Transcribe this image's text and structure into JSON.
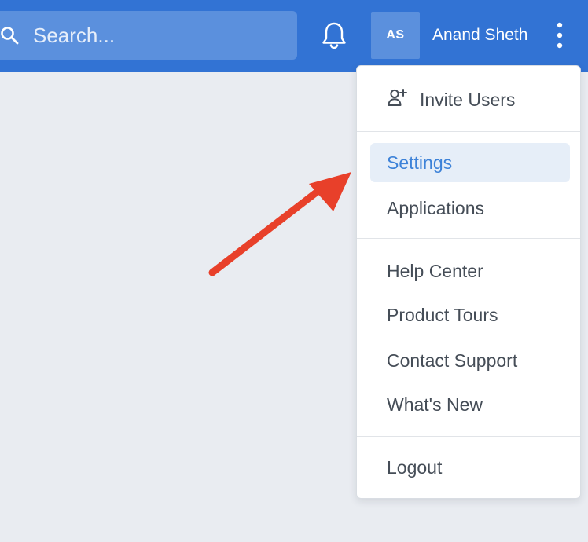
{
  "header": {
    "search_placeholder": "Search...",
    "user_initials": "AS",
    "user_name": "Anand Sheth",
    "icons": {
      "search": "search-icon",
      "notifications": "bell-icon",
      "more": "kebab-vertical-icon"
    }
  },
  "menu": {
    "invite_users": {
      "label": "Invite Users",
      "icon": "add-user-icon"
    },
    "settings": {
      "label": "Settings",
      "active": true
    },
    "applications": {
      "label": "Applications"
    },
    "help_center": {
      "label": "Help Center"
    },
    "product_tours": {
      "label": "Product Tours"
    },
    "contact_support": {
      "label": "Contact Support"
    },
    "whats_new": {
      "label": "What's New"
    },
    "logout": {
      "label": "Logout"
    }
  },
  "annotation": {
    "type": "arrow",
    "points_to": "Settings",
    "color": "#e8402a"
  },
  "colors": {
    "header_bg": "#3273d4",
    "search_bg": "#5b90dd",
    "page_bg": "#e9ecf1",
    "menu_text": "#454d57",
    "active_bg": "#e6eef8",
    "active_text": "#3d82d8"
  }
}
